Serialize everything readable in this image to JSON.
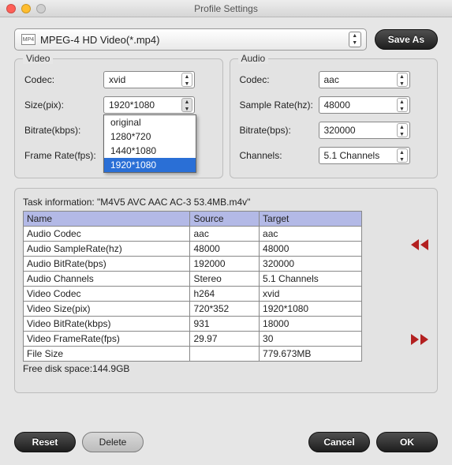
{
  "title": "Profile Settings",
  "profile": {
    "label": "MPEG-4 HD Video(*.mp4)",
    "icon_text": "MP4"
  },
  "buttons": {
    "save_as": "Save As",
    "reset": "Reset",
    "delete": "Delete",
    "cancel": "Cancel",
    "ok": "OK"
  },
  "video": {
    "title": "Video",
    "codec_label": "Codec:",
    "codec_value": "xvid",
    "size_label": "Size(pix):",
    "size_value": "1920*1080",
    "size_options": [
      "original",
      "1280*720",
      "1440*1080",
      "1920*1080"
    ],
    "size_selected_index": 3,
    "bitrate_label": "Bitrate(kbps):",
    "framerate_label": "Frame Rate(fps):"
  },
  "audio": {
    "title": "Audio",
    "codec_label": "Codec:",
    "codec_value": "aac",
    "samplerate_label": "Sample Rate(hz):",
    "samplerate_value": "48000",
    "bitrate_label": "Bitrate(bps):",
    "bitrate_value": "320000",
    "channels_label": "Channels:",
    "channels_value": "5.1 Channels"
  },
  "task": {
    "title_prefix": "Task information: ",
    "title_file": "\"M4V5 AVC AAC AC-3 53.4MB.m4v\"",
    "headers": [
      "Name",
      "Source",
      "Target"
    ],
    "rows": [
      [
        "Audio Codec",
        "aac",
        "aac"
      ],
      [
        "Audio SampleRate(hz)",
        "48000",
        "48000"
      ],
      [
        "Audio BitRate(bps)",
        "192000",
        "320000"
      ],
      [
        "Audio Channels",
        "Stereo",
        "5.1 Channels"
      ],
      [
        "Video Codec",
        "h264",
        "xvid"
      ],
      [
        "Video Size(pix)",
        "720*352",
        "1920*1080"
      ],
      [
        "Video BitRate(kbps)",
        "931",
        "18000"
      ],
      [
        "Video FrameRate(fps)",
        "29.97",
        "30"
      ],
      [
        "File Size",
        "",
        "779.673MB"
      ]
    ],
    "free_disk": "Free disk space:144.9GB"
  }
}
